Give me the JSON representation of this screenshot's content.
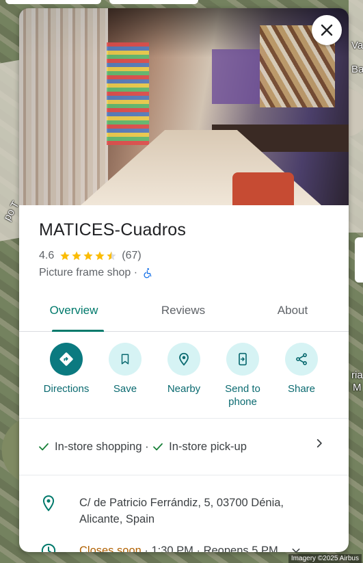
{
  "map": {
    "labels": [
      "Va",
      "Ba",
      "po T",
      "ria",
      "M"
    ],
    "attribution": "Imagery ©2025 Airbus"
  },
  "place": {
    "name": "MATICES-Cuadros",
    "rating": "4.6",
    "stars": 4.5,
    "review_count": "(67)",
    "category": "Picture frame shop",
    "separator": " · "
  },
  "tabs": [
    {
      "label": "Overview",
      "active": true
    },
    {
      "label": "Reviews",
      "active": false
    },
    {
      "label": "About",
      "active": false
    }
  ],
  "actions": [
    {
      "label": "Directions",
      "icon": "directions-icon"
    },
    {
      "label": "Save",
      "icon": "bookmark-icon"
    },
    {
      "label": "Nearby",
      "icon": "nearby-icon"
    },
    {
      "label": "Send to phone",
      "icon": "send-to-phone-icon"
    },
    {
      "label": "Share",
      "icon": "share-icon"
    }
  ],
  "features": {
    "item1": "In-store shopping",
    "sep": " · ",
    "item2": "In-store pick-up"
  },
  "address": {
    "line1": "C/ de Patricio Ferrándiz, 5, 03700 Dénia,",
    "line2": "Alicante, Spain"
  },
  "hours": {
    "status": "Closes soon",
    "detail": " · 1:30 PM · Reopens 5 PM"
  },
  "colors": {
    "accent": "#00796b",
    "star": "#fbbc04",
    "closes_soon": "#b06000"
  }
}
